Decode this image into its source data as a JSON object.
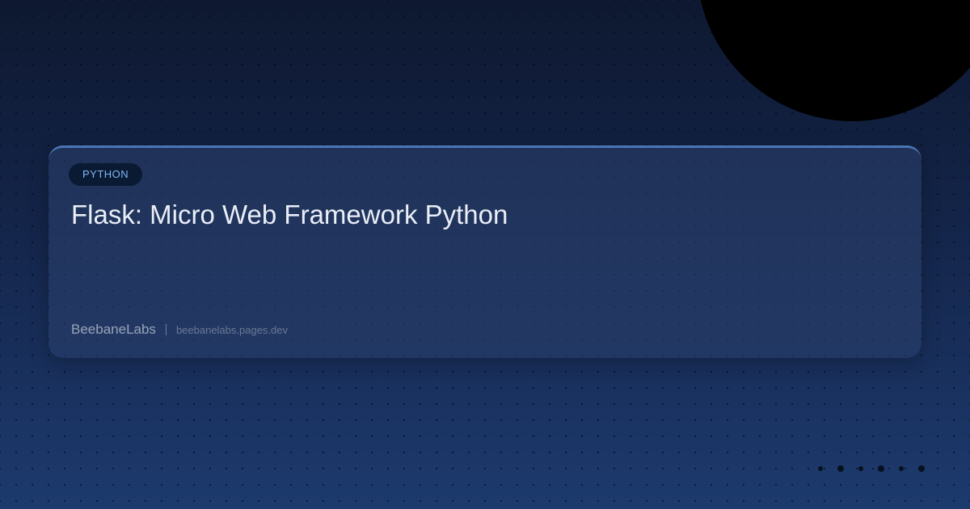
{
  "card": {
    "badge": "PYTHON",
    "title": "Flask: Micro Web Framework Python",
    "brand": "BeebaneLabs",
    "separator": "|",
    "site": "beebanelabs.pages.dev"
  }
}
